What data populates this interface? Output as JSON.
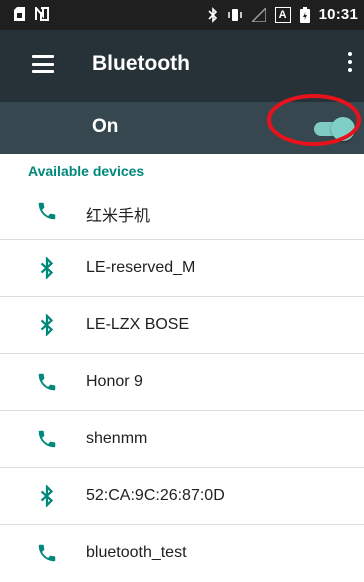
{
  "status_bar": {
    "time": "10:31",
    "icons": [
      "sim-icon",
      "nfc-icon",
      "bluetooth-status-icon",
      "vibrate-icon",
      "signal-icon",
      "a-badge-icon",
      "battery-icon"
    ],
    "badge_text": "A"
  },
  "app_bar": {
    "title": "Bluetooth",
    "menu_icon": "hamburger-menu-icon",
    "overflow_icon": "more-vert-icon"
  },
  "bluetooth_switch": {
    "label": "On",
    "checked": true
  },
  "colors": {
    "accent": "#00897b",
    "app_bar": "#263238",
    "switch_bar": "#37474f",
    "toggle": "#80cbc4",
    "annotation": "#e8121c"
  },
  "available_devices": {
    "header": "Available devices",
    "devices": [
      {
        "name": "红米手机",
        "icon": "phone-icon"
      },
      {
        "name": "LE-reserved_M",
        "icon": "bluetooth-icon"
      },
      {
        "name": "LE-LZX BOSE",
        "icon": "bluetooth-icon"
      },
      {
        "name": "Honor 9",
        "icon": "phone-icon"
      },
      {
        "name": "shenmm",
        "icon": "phone-icon"
      },
      {
        "name": "52:CA:9C:26:87:0D",
        "icon": "bluetooth-icon"
      },
      {
        "name": "bluetooth_test",
        "icon": "phone-icon"
      }
    ]
  }
}
